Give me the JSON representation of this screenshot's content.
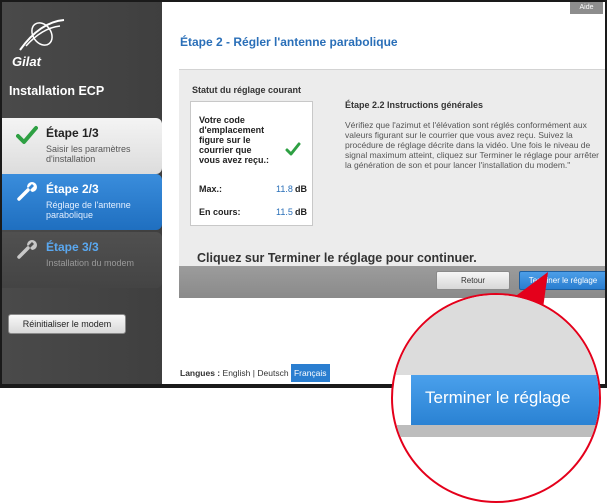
{
  "sidebar": {
    "logo_text": "Gilat",
    "title": "Installation ECP",
    "steps": [
      {
        "title": "Étape 1/3",
        "desc": "Saisir les paramètres d'installation",
        "icon": "check-icon"
      },
      {
        "title": "Étape 2/3",
        "desc": "Réglage de l'antenne parabolique",
        "icon": "wrench-icon"
      },
      {
        "title": "Étape 3/3",
        "desc": "Installation du modem",
        "icon": "wrench-icon"
      }
    ],
    "reset_label": "Réinitialiser le modem"
  },
  "header": {
    "help_label": "Aide",
    "page_title": "Étape 2 - Régler l'antenne parabolique"
  },
  "status": {
    "heading": "Statut du réglage courant",
    "code_label": "Votre code d'emplacement figure sur le courrier que vous avez reçu.:",
    "max_label": "Max.:",
    "max_value": "11.8",
    "current_label": "En cours:",
    "current_value": "11.5",
    "unit": "dB"
  },
  "instructions": {
    "heading": "Étape 2.2 Instructions générales",
    "body": "Vérifiez que l'azimut et l'élévation sont réglés conformément aux valeurs figurant sur le courrier que vous avez reçu. Suivez la procédure de réglage décrite dans la vidéo. Une fois le niveau de signal maximum atteint, cliquez sur Terminer le réglage pour arrêter la génération de son et pour lancer l'installation du modem.\""
  },
  "actions": {
    "cta": "Cliquez sur Terminer le réglage pour continuer.",
    "back_label": "Retour",
    "finish_label": "Terminer le réglage"
  },
  "languages": {
    "label": "Langues :",
    "english": "English",
    "separator": "|",
    "deutsch": "Deutsch",
    "francais": "Français"
  },
  "callout": {
    "zoom_label": "Terminer le réglage",
    "accent": "#e4001b"
  },
  "colors": {
    "brand_blue": "#2a7ed0",
    "success_green": "#2ea043"
  }
}
